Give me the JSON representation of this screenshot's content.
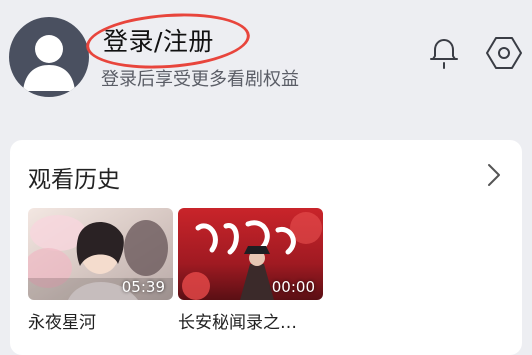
{
  "header": {
    "title": "登录/注册",
    "subtitle": "登录后享受更多看剧权益",
    "avatar_icon": "default-user-avatar-icon",
    "actions": [
      {
        "icon": "bell-icon"
      },
      {
        "icon": "hexagon-settings-icon"
      }
    ],
    "highlight_color": "#e8453c"
  },
  "history": {
    "title": "观看历史",
    "more_icon": "chevron-right-icon",
    "items": [
      {
        "title": "永夜星河",
        "duration": "05:39"
      },
      {
        "title": "长安秘闻录之…",
        "duration": "00:00"
      }
    ]
  }
}
